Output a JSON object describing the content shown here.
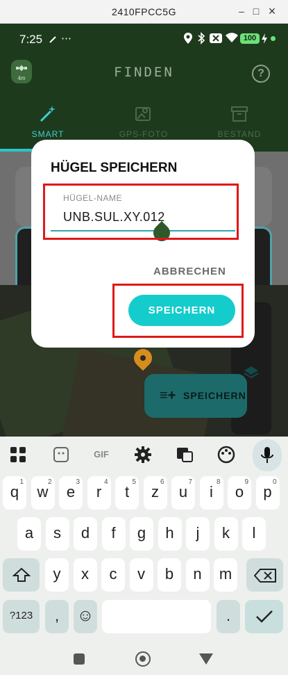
{
  "window": {
    "title": "2410FPCC5G",
    "min": "–",
    "max": "□",
    "close": "×"
  },
  "status_bar": {
    "time": "7:25",
    "extra": "⋯",
    "battery": "100"
  },
  "app_bar": {
    "title": "FINDEN",
    "sat_label": "4m",
    "help": "?"
  },
  "tabs": [
    {
      "label": "SMART",
      "active": true
    },
    {
      "label": "GPS-FOTO",
      "active": false
    },
    {
      "label": "BESTAND",
      "active": false
    }
  ],
  "fab": {
    "label": "SPEICHERN",
    "icon": "≡+"
  },
  "dialog": {
    "title": "HÜGEL SPEICHERN",
    "field_label": "HÜGEL-NAME",
    "field_value": "UNB.SUL.XY.012",
    "cancel": "ABBRECHEN",
    "save": "SPEICHERN"
  },
  "keyboard": {
    "toolbar": [
      "apps-icon",
      "sticker-icon",
      "GIF",
      "gear-icon",
      "translate-icon",
      "palette-icon",
      "mic-icon"
    ],
    "gif_label": "GIF",
    "row1": [
      {
        "k": "q",
        "n": "1"
      },
      {
        "k": "w",
        "n": "2"
      },
      {
        "k": "e",
        "n": "3"
      },
      {
        "k": "r",
        "n": "4"
      },
      {
        "k": "t",
        "n": "5"
      },
      {
        "k": "z",
        "n": "6"
      },
      {
        "k": "u",
        "n": "7"
      },
      {
        "k": "i",
        "n": "8"
      },
      {
        "k": "o",
        "n": "9"
      },
      {
        "k": "p",
        "n": "0"
      }
    ],
    "row2": [
      "a",
      "s",
      "d",
      "f",
      "g",
      "h",
      "j",
      "k",
      "l"
    ],
    "row3": [
      "y",
      "x",
      "c",
      "v",
      "b",
      "n",
      "m"
    ],
    "sym": "?123",
    "comma": ",",
    "emoji": "☺",
    "period": "."
  }
}
